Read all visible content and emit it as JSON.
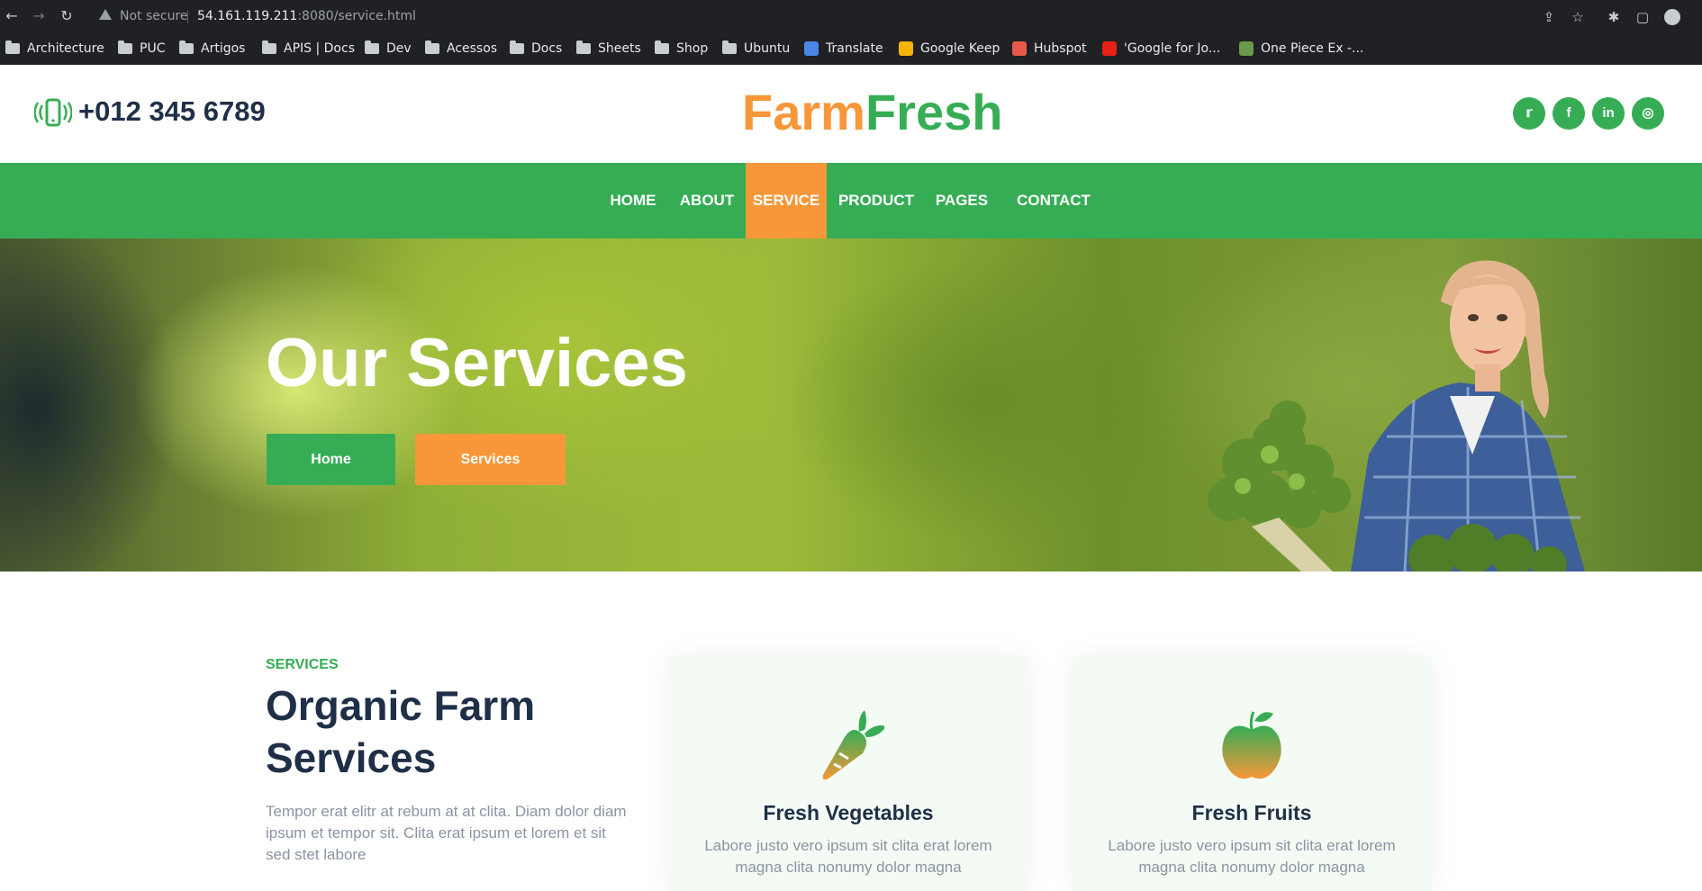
{
  "browser": {
    "security_label": "Not secure",
    "url_host": "54.161.119.211",
    "url_rest": ":8080/service.html",
    "bookmarks": [
      "Architecture",
      "PUC",
      "Artigos",
      "APIS | Docs",
      "Dev",
      "Acessos",
      "Docs",
      "Sheets",
      "Shop",
      "Ubuntu",
      "Translate",
      "Google Keep",
      "Hubspot",
      "'Google for Jo...",
      "One Piece Ex -..."
    ]
  },
  "topbar": {
    "phone": "+012 345 6789",
    "logo_part1": "Farm",
    "logo_part2": "Fresh",
    "social": [
      "twitter-icon",
      "facebook-icon",
      "linkedin-icon",
      "instagram-icon"
    ]
  },
  "nav": {
    "items": [
      "HOME",
      "ABOUT",
      "SERVICE",
      "PRODUCT",
      "PAGES",
      "CONTACT"
    ],
    "active": "SERVICE"
  },
  "hero": {
    "title": "Our Services",
    "btn_home": "Home",
    "btn_services": "Services"
  },
  "services": {
    "kicker": "SERVICES",
    "title": "Organic Farm Services",
    "text": "Tempor erat elitr at rebum at at clita. Diam dolor diam ipsum et tempor sit. Clita erat ipsum et lorem et sit sed stet labore",
    "cards": [
      {
        "title": "Fresh Vegetables",
        "desc": "Labore justo vero ipsum sit clita erat lorem magna clita nonumy dolor magna"
      },
      {
        "title": "Fresh Fruits",
        "desc": "Labore justo vero ipsum sit clita erat lorem magna clita nonumy dolor magna"
      }
    ]
  },
  "colors": {
    "brand_green": "#36ad55",
    "brand_orange": "#f7973a",
    "dark_text": "#1f2f47"
  }
}
